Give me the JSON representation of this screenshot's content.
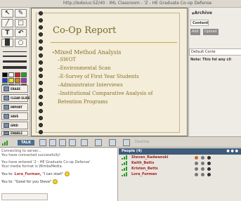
{
  "browser": {
    "url": "http://ledoius:5Z/40 - IML Classroom - 'Z - HE Graduate Co-op Defense"
  },
  "slide": {
    "title": "Co-Op Report",
    "bullet": "Mixed Method Analysis",
    "subitems": [
      "SWOT",
      "Environmental Scan",
      "E-Survey of First Year Students",
      "Administrator Interviews",
      "Institutional Comparative Analysis of Retention Programs"
    ]
  },
  "toolbar": {
    "buttons": [
      "ERASE",
      "CLEAR SLIDE",
      "IMPORT",
      "SAVE",
      "GRID",
      "ENABLE"
    ],
    "swatch_colors": [
      "#000000",
      "#ffffff",
      "#d62020",
      "#2aa02a",
      "#2040d0",
      "#f0e020",
      "#e08020",
      "#a030c0",
      "#20b0c0",
      "#808080",
      "#c0c0c0",
      "#804020"
    ]
  },
  "right_panel": {
    "archive": "Archive",
    "content_tab": "Content",
    "buttons": [
      "Add",
      "Upload"
    ],
    "default_content": "Default Conte",
    "note": "Note: This fol any cli"
  },
  "mediabar": {
    "talk": "TALK",
    "desktop": "Desktop"
  },
  "chat": {
    "messages": [
      {
        "type": "sys",
        "text": "Connecting to server..."
      },
      {
        "type": "sys",
        "text": "You have connected successfully!"
      },
      {
        "type": "sys",
        "text": "You have entered '2 - HE Graduate Co-op Defense'."
      },
      {
        "type": "sys",
        "text": "Your media format is WimbaMedia."
      },
      {
        "type": "msg",
        "prefix": "You to:",
        "name": "Lora_Furman,",
        "text": "\"I can start\""
      },
      {
        "type": "msg",
        "prefix": "You to:",
        "name": "",
        "text": "\"Good for you Steve\""
      }
    ]
  },
  "people": {
    "header": "People (4)",
    "list": [
      "Steven_Radwanski",
      "Keith_Betts",
      "Kristen_Betts",
      "Lora_Furman"
    ]
  },
  "colors": {
    "accent": "#3e5b7a",
    "slide_bg": "#f3edd9",
    "name_red": "#a02424"
  }
}
